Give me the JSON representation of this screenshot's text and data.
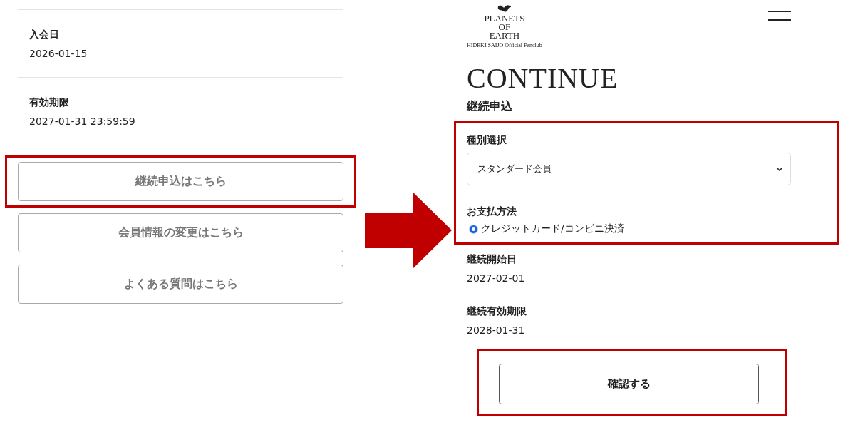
{
  "left_screen": {
    "fields": [
      {
        "label": "入会日",
        "value": "2026-01-15"
      },
      {
        "label": "有効期限",
        "value": "2027-01-31 23:59:59"
      }
    ],
    "buttons": [
      {
        "label": "継続申込はこちら",
        "highlighted": true
      },
      {
        "label": "会員情報の変更はこちら",
        "highlighted": false
      },
      {
        "label": "よくある質問はこちら",
        "highlighted": false
      }
    ]
  },
  "right_screen": {
    "logo": {
      "lines": [
        "PLANETS",
        "OF",
        "EARTH"
      ],
      "tagline": "HIDEKI SAIJO Official Fanclub"
    },
    "heading": "CONTINUE",
    "subheading": "継続申込",
    "form": {
      "highlighted": true,
      "type_label": "種別選択",
      "type_select": {
        "value": "スタンダード会員"
      },
      "payment_label": "お支払方法",
      "payment_options": [
        {
          "label": "クレジットカード/コンビニ決済",
          "selected": true
        }
      ]
    },
    "details": [
      {
        "label": "継続開始日",
        "value": "2027-02-01"
      },
      {
        "label": "継続有効期限",
        "value": "2028-01-31"
      }
    ],
    "confirm_button": {
      "label": "確認する",
      "highlighted": true
    }
  }
}
